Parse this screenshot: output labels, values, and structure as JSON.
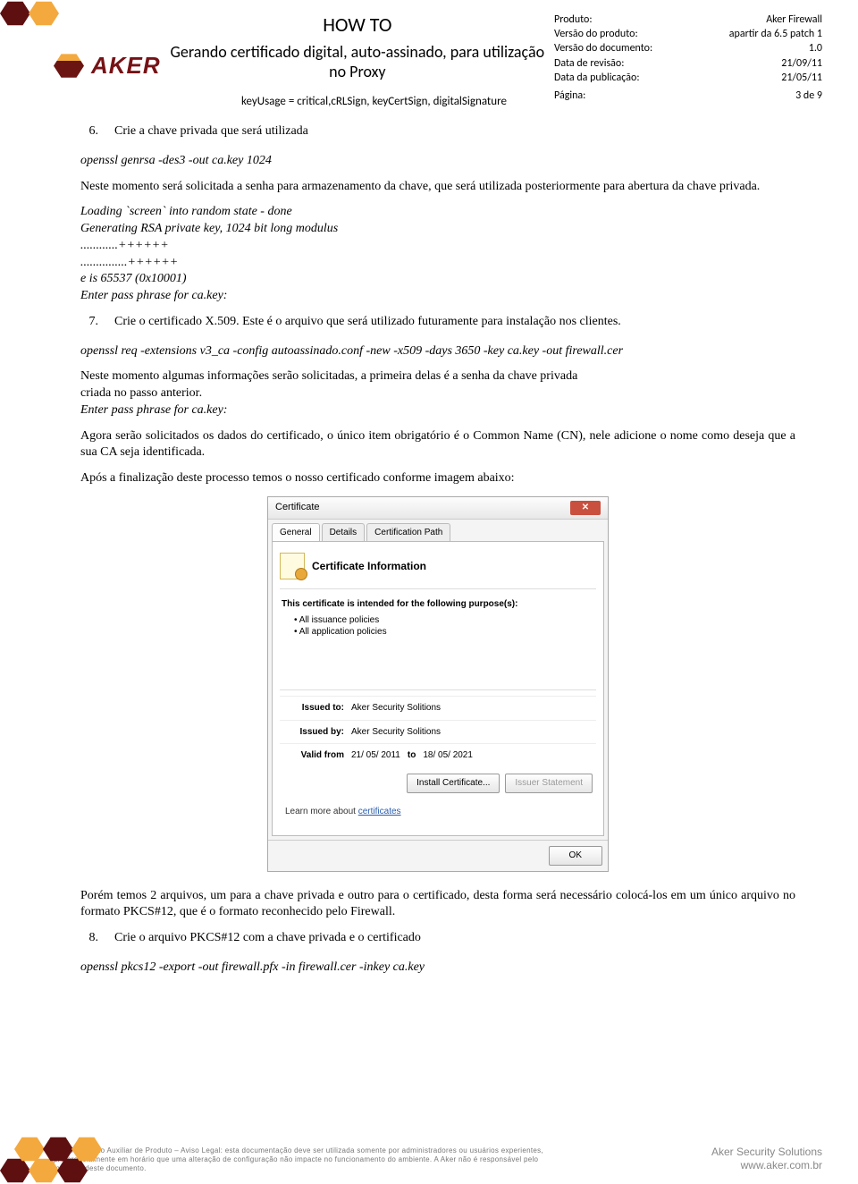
{
  "header": {
    "howto": "HOW TO",
    "subtitle": "Gerando certificado digital, auto-assinado, para utilização no Proxy",
    "codeline": "keyUsage = critical,cRLSign, keyCertSign, digitalSignature",
    "brand": "AKER"
  },
  "meta": {
    "produto_l": "Produto:",
    "produto_v": "Aker Firewall",
    "versaoprod_l": "Versão do produto:",
    "versaoprod_v": "apartir da 6.5 patch 1",
    "versaodoc_l": "Versão do documento:",
    "versaodoc_v": "1.0",
    "revisao_l": "Data de revisão:",
    "revisao_v": "21/09/11",
    "pub_l": "Data da publicação:",
    "pub_v": "21/05/11",
    "pagina_l": "Página:",
    "pagina_v": "3  de 9"
  },
  "step6": {
    "n": "6.",
    "title": "Crie a chave privada que será utilizada",
    "cmd": "openssl genrsa -des3 -out ca.key 1024",
    "p1": "Neste momento será solicitada a senha para armazenamento da chave, que será utilizada posteriormente para abertura da chave privada.",
    "out1": "Loading `screen` into random state - done",
    "out2": "Generating RSA private key, 1024 bit long modulus",
    "out3": "............++++++",
    "out4": "...............++++++",
    "out5": "e is 65537 (0x10001)",
    "out6": "Enter pass phrase for ca.key:"
  },
  "step7": {
    "n": "7.",
    "title": "Crie o certificado X.509. Este é o arquivo que será utilizado futuramente para instalação nos clientes.",
    "cmd": "openssl req -extensions v3_ca -config autoassinado.conf -new -x509 -days 3650 -key ca.key -out firewall.cer",
    "p1": "Neste momento algumas informações serão solicitadas, a primeira delas é a senha da chave privada",
    "p1b": "criada no passo anterior.",
    "out1": "Enter pass phrase for ca.key:",
    "p2": "Agora serão solicitados os dados do certificado, o único item obrigatório é o Common Name (CN), nele adicione o nome como deseja que a sua CA seja identificada.",
    "p3": "Após a finalização deste processo temos o nosso certificado conforme imagem abaixo:",
    "pAfter": "Porém temos 2 arquivos, um para a chave privada e outro para o certificado, desta forma será necessário colocá-los em um único arquivo no formato PKCS#12, que é o formato reconhecido pelo Firewall."
  },
  "cert": {
    "title": "Certificate",
    "tab1": "General",
    "tab2": "Details",
    "tab3": "Certification Path",
    "header": "Certificate Information",
    "intended": "This certificate is intended for the following purpose(s):",
    "pol1": "All issuance policies",
    "pol2": "All application policies",
    "issuedto_l": "Issued to:",
    "issuedto_v": "Aker Security Solitions",
    "issuedby_l": "Issued by:",
    "issuedby_v": "Aker Security Solitions",
    "valid_l": "Valid from",
    "valid_from": "21/ 05/ 2011",
    "valid_to_l": "to",
    "valid_to": "18/ 05/ 2021",
    "install": "Install Certificate...",
    "issuer": "Issuer Statement",
    "learn": "Learn more about",
    "learn_link": "certificates",
    "ok": "OK"
  },
  "step8": {
    "n": "8.",
    "title": "Crie o arquivo PKCS#12 com a chave privada e o certificado",
    "cmd": "openssl pkcs12 -export -out firewall.pfx -in firewall.cer -inkey ca.key"
  },
  "footer": {
    "disclaimer": "Documentação Auxiliar de Produto – Aviso Legal: esta documentação deve ser utilizada somente por administradores ou usuários experientes, preferencialmente em horário que uma alteração de configuração não impacte no funcionamento do ambiente. A Aker não é responsável pelo mau uso deste documento.",
    "company": "Aker Security Solutions",
    "url": "www.aker.com.br"
  }
}
